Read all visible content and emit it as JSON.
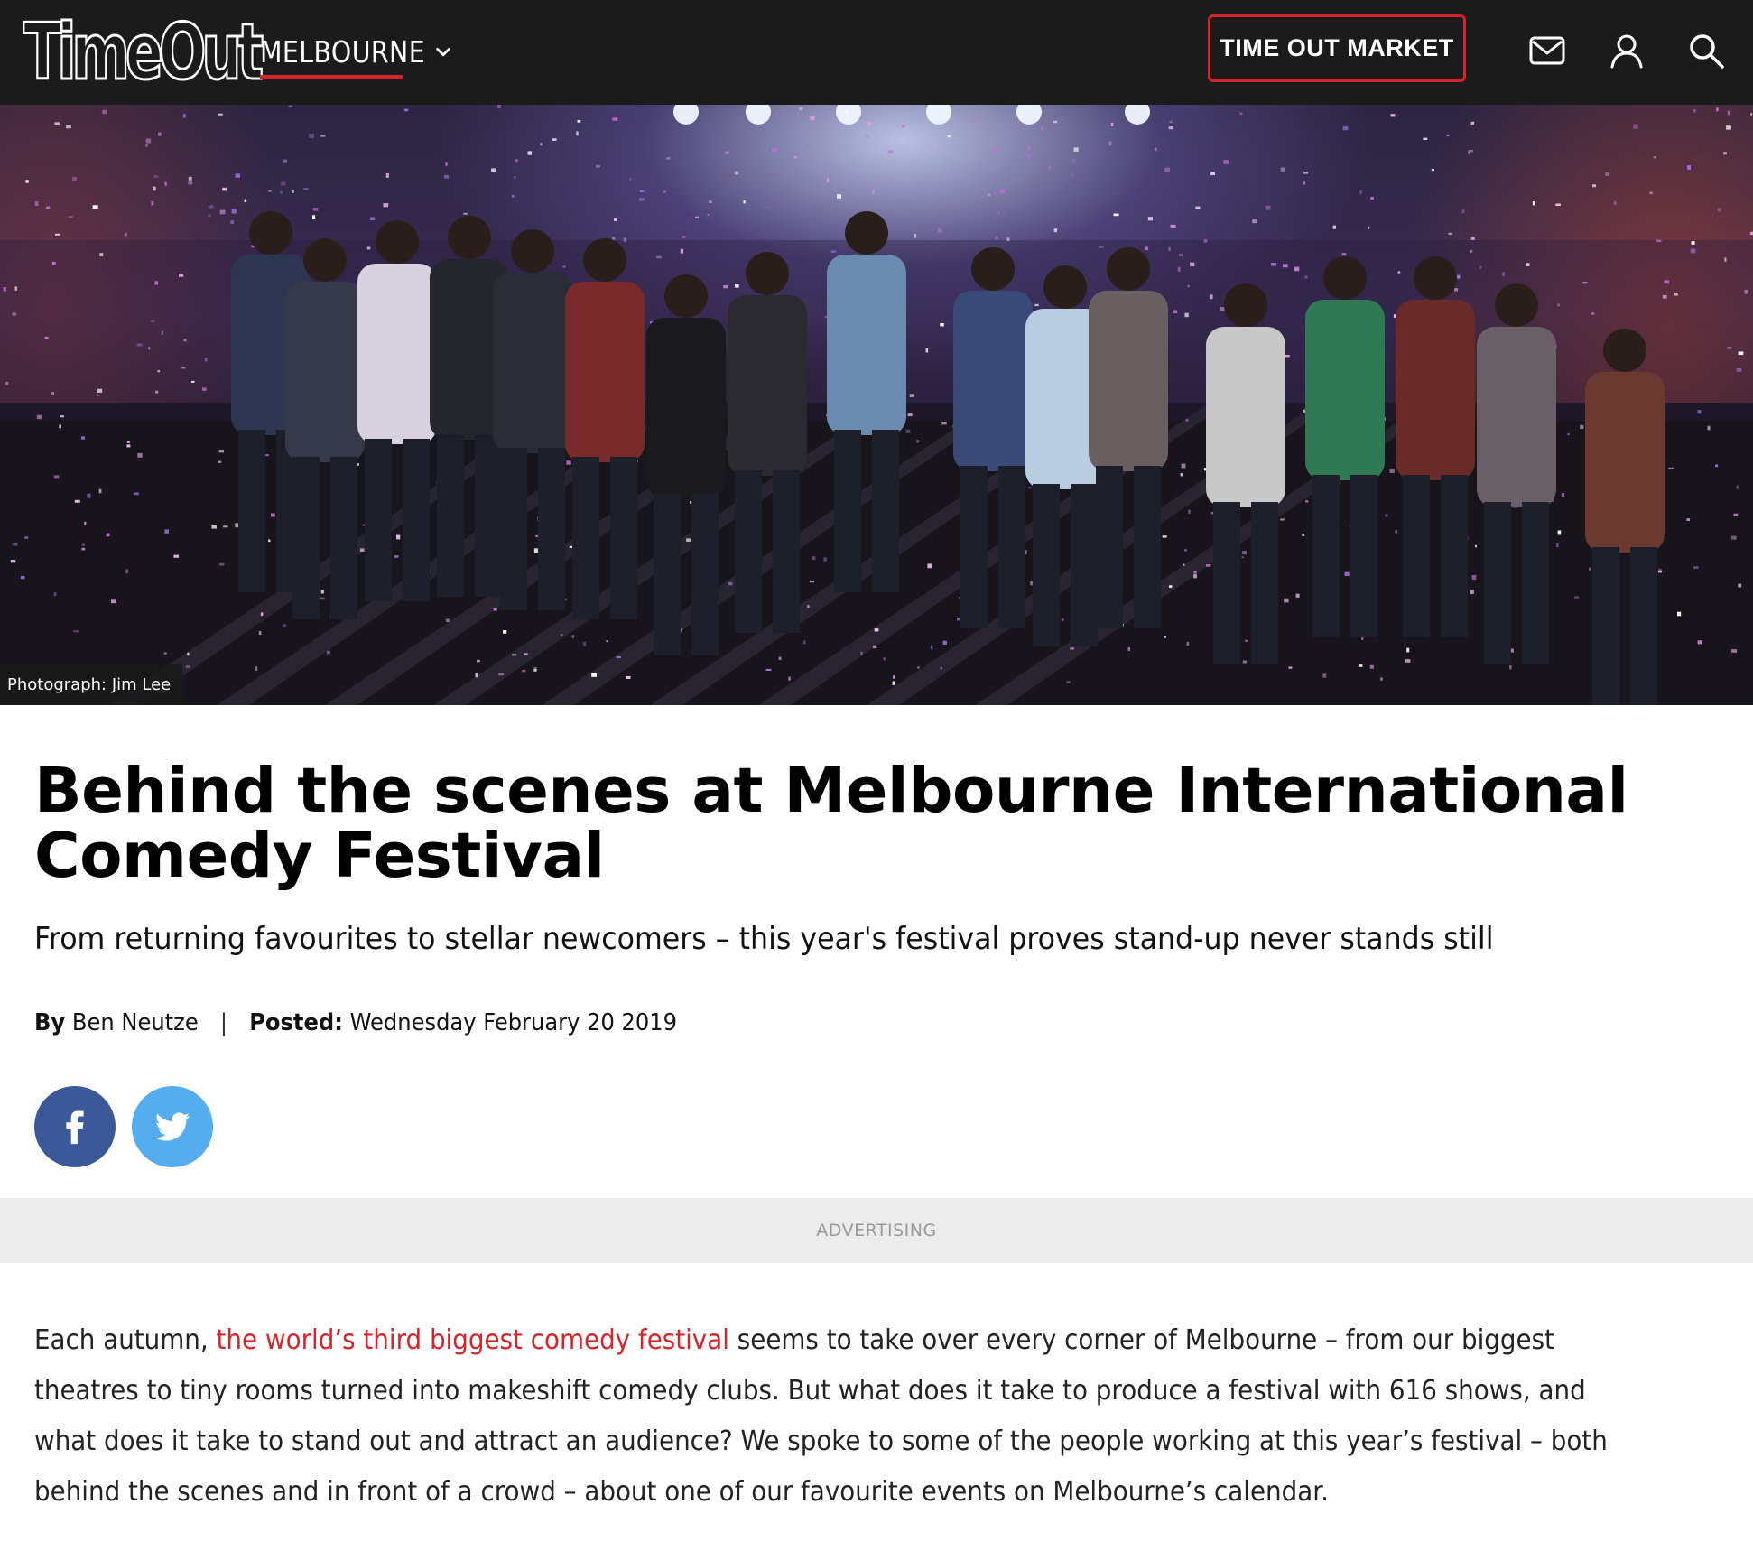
{
  "header": {
    "logo_text": "TimeOut",
    "city": "MELBOURNE",
    "market_button": "TIME OUT MARKET",
    "icons": [
      "mail-icon",
      "user-icon",
      "search-icon"
    ],
    "colors": {
      "background": "#1b1b1b",
      "accent": "#d6242b"
    }
  },
  "hero": {
    "caption": "Photograph: Jim Lee"
  },
  "article": {
    "title": "Behind the scenes at Melbourne International Comedy Festival",
    "subtitle": "From returning favourites to stellar newcomers – this year's festival proves stand-up never stands still",
    "byline": {
      "by_label": "By",
      "author": "Ben Neutze",
      "separator": "|",
      "posted_label": "Posted:",
      "date": "Wednesday February 20 2019"
    },
    "share": [
      {
        "network": "facebook",
        "icon": "facebook-icon",
        "color": "#3b5998"
      },
      {
        "network": "twitter",
        "icon": "twitter-icon",
        "color": "#55acee"
      }
    ],
    "ad_label": "ADVERTISING",
    "body": {
      "intro": "Each autumn, ",
      "link_text": "the world’s third biggest comedy festival",
      "rest": " seems to take over every corner of Melbourne – from our biggest theatres to tiny rooms turned into makeshift comedy clubs. But what does it take to produce a festival with 616 shows, and what does it take to stand out and attract an audience? We spoke to some of the people working at this year’s festival – both behind the scenes and in front of a crowd – about one of our favourite events on Melbourne’s calendar.",
      "link_color": "#d6242b"
    }
  }
}
